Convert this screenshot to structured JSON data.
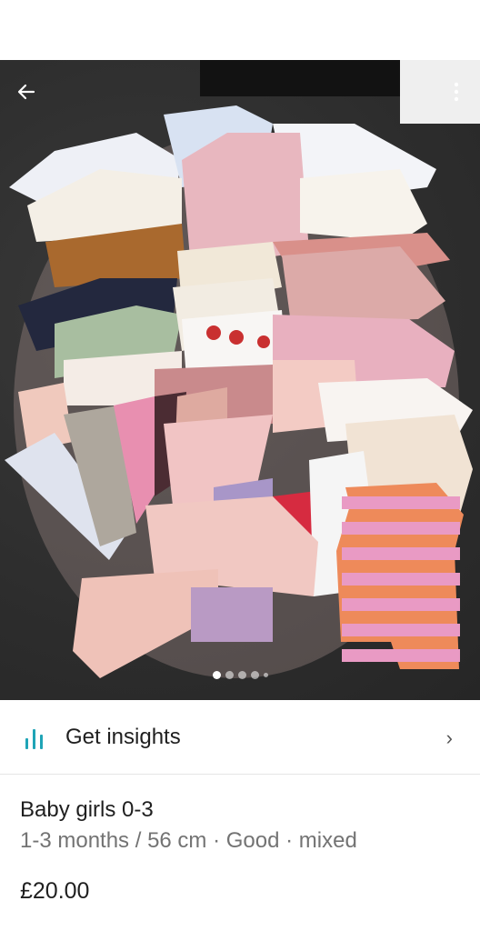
{
  "listing": {
    "title": "Baby girls 0-3",
    "subtitle": "1-3 months / 56 cm · Good · mixed",
    "price": "£20.00"
  },
  "insights": {
    "label": "Get insights",
    "icon": "bar-chart-icon",
    "accent_color": "#1fa4b6"
  },
  "photo": {
    "icons": [
      "back-arrow-icon",
      "more-vertical-icon"
    ],
    "carousel_active_index": 0
  }
}
